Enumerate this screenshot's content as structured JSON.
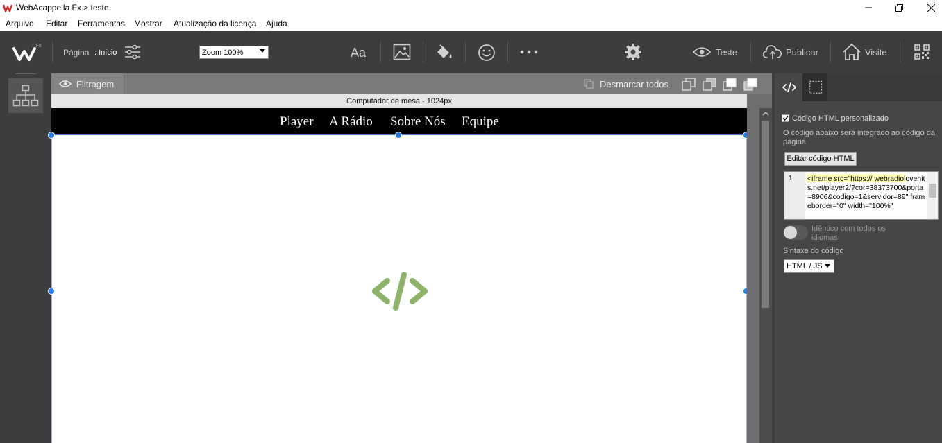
{
  "window": {
    "title": "WebAcappella Fx > teste"
  },
  "menu": [
    "Arquivo",
    "Editar",
    "Ferramentas",
    "Mostrar",
    "Atualização da licença",
    "Ajuda"
  ],
  "toolbar": {
    "page_label": "Página",
    "page_value": ": Início",
    "zoom_value": "Zoom 100%",
    "test_label": "Teste",
    "publish_label": "Publicar",
    "visit_label": "Visite"
  },
  "filterbar": {
    "filter_label": "Filtragem",
    "deselect_label": "Desmarcar todos"
  },
  "canvas": {
    "ruler_label": "Computador de mesa - 1024px",
    "nav_items": [
      "Player",
      "A Rádio",
      "Sobre Nós",
      "Equipe"
    ]
  },
  "panel": {
    "custom_html_label": "Código HTML personalizado",
    "custom_html_checked": true,
    "description": "O código abaixo será integrado ao código da página",
    "edit_button": "Editar código HTML",
    "code_line_number": "1",
    "code_text": "<iframe src=\"https:// webradiolovehits.net/player2/?cor=38373700&porta=8906&codigo=1&servidor=89\" frameborder=\"0\" width=\"100%\"",
    "same_all_languages_label": "Idêntico com todos os idiomas",
    "same_all_languages_on": false,
    "syntax_label": "Sintaxe do código",
    "syntax_value": "HTML / JS"
  },
  "colors": {
    "accent_blue": "#2a7ae2",
    "code_icon_green": "#8db26a",
    "toolbar_bg": "#3d3d3d"
  },
  "icons": [
    "app-logo-icon",
    "settings-sliders-icon",
    "text-icon",
    "image-icon",
    "paint-bucket-icon",
    "emoji-icon",
    "more-icon",
    "gear-icon",
    "eye-icon",
    "upload-cloud-icon",
    "home-icon",
    "qr-code-icon",
    "sitemap-icon",
    "html-code-icon"
  ]
}
